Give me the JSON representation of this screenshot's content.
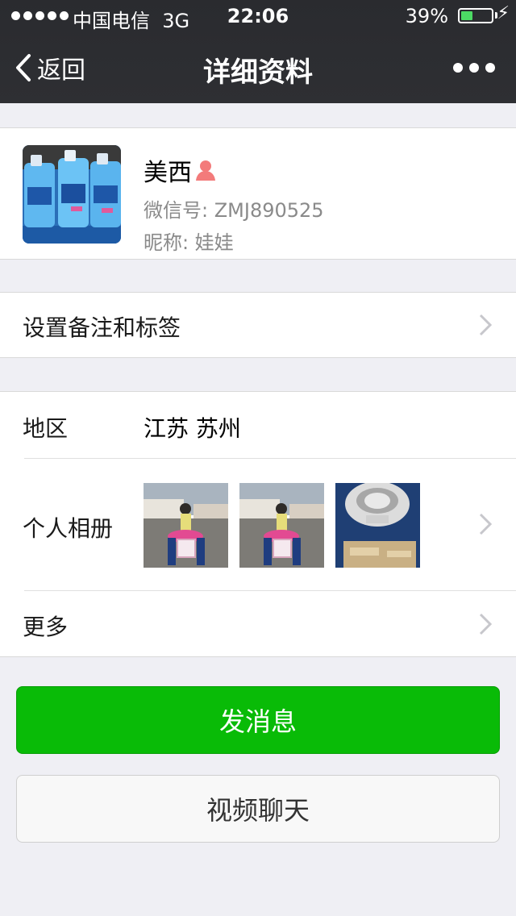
{
  "status_bar": {
    "carrier": "中国电信",
    "network": "3G",
    "time": "22:06",
    "battery_percent": "39%",
    "battery_level": 0.39,
    "signal_bars": 5
  },
  "nav": {
    "back_label": "返回",
    "title": "详细资料"
  },
  "profile": {
    "name": "美西",
    "gender_icon": "female-icon",
    "wechat_id_label": "微信号:",
    "wechat_id": "ZMJ890525",
    "nickname_label": "昵称:",
    "nickname": "娃娃"
  },
  "remark": {
    "label": "设置备注和标签"
  },
  "info": {
    "region_label": "地区",
    "region_value": "江苏 苏州",
    "album_label": "个人相册",
    "more_label": "更多"
  },
  "buttons": {
    "send_message": "发消息",
    "video_chat": "视频聊天"
  },
  "colors": {
    "nav_bg": "#2e2f33",
    "primary_green": "#09bb07",
    "battery_green": "#4cd964",
    "female_icon": "#f37b7b"
  }
}
